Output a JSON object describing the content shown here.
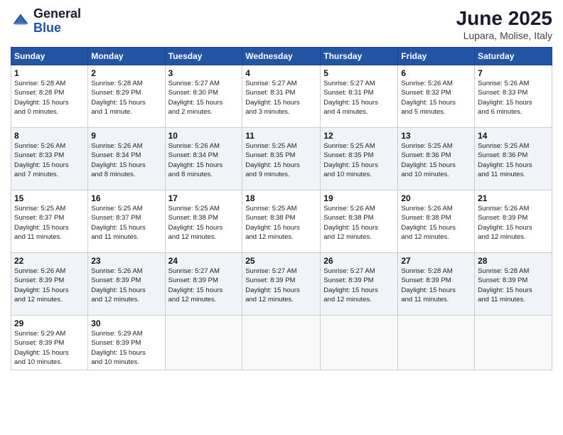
{
  "logo": {
    "general": "General",
    "blue": "Blue"
  },
  "title": "June 2025",
  "location": "Lupara, Molise, Italy",
  "days_header": [
    "Sunday",
    "Monday",
    "Tuesday",
    "Wednesday",
    "Thursday",
    "Friday",
    "Saturday"
  ],
  "weeks": [
    [
      {
        "day": "1",
        "sunrise": "5:28 AM",
        "sunset": "8:28 PM",
        "daylight": "15 hours and 0 minutes."
      },
      {
        "day": "2",
        "sunrise": "5:28 AM",
        "sunset": "8:29 PM",
        "daylight": "15 hours and 1 minute."
      },
      {
        "day": "3",
        "sunrise": "5:27 AM",
        "sunset": "8:30 PM",
        "daylight": "15 hours and 2 minutes."
      },
      {
        "day": "4",
        "sunrise": "5:27 AM",
        "sunset": "8:31 PM",
        "daylight": "15 hours and 3 minutes."
      },
      {
        "day": "5",
        "sunrise": "5:27 AM",
        "sunset": "8:31 PM",
        "daylight": "15 hours and 4 minutes."
      },
      {
        "day": "6",
        "sunrise": "5:26 AM",
        "sunset": "8:32 PM",
        "daylight": "15 hours and 5 minutes."
      },
      {
        "day": "7",
        "sunrise": "5:26 AM",
        "sunset": "8:33 PM",
        "daylight": "15 hours and 6 minutes."
      }
    ],
    [
      {
        "day": "8",
        "sunrise": "5:26 AM",
        "sunset": "8:33 PM",
        "daylight": "15 hours and 7 minutes."
      },
      {
        "day": "9",
        "sunrise": "5:26 AM",
        "sunset": "8:34 PM",
        "daylight": "15 hours and 8 minutes."
      },
      {
        "day": "10",
        "sunrise": "5:26 AM",
        "sunset": "8:34 PM",
        "daylight": "15 hours and 8 minutes."
      },
      {
        "day": "11",
        "sunrise": "5:25 AM",
        "sunset": "8:35 PM",
        "daylight": "15 hours and 9 minutes."
      },
      {
        "day": "12",
        "sunrise": "5:25 AM",
        "sunset": "8:35 PM",
        "daylight": "15 hours and 10 minutes."
      },
      {
        "day": "13",
        "sunrise": "5:25 AM",
        "sunset": "8:36 PM",
        "daylight": "15 hours and 10 minutes."
      },
      {
        "day": "14",
        "sunrise": "5:25 AM",
        "sunset": "8:36 PM",
        "daylight": "15 hours and 11 minutes."
      }
    ],
    [
      {
        "day": "15",
        "sunrise": "5:25 AM",
        "sunset": "8:37 PM",
        "daylight": "15 hours and 11 minutes."
      },
      {
        "day": "16",
        "sunrise": "5:25 AM",
        "sunset": "8:37 PM",
        "daylight": "15 hours and 11 minutes."
      },
      {
        "day": "17",
        "sunrise": "5:25 AM",
        "sunset": "8:38 PM",
        "daylight": "15 hours and 12 minutes."
      },
      {
        "day": "18",
        "sunrise": "5:25 AM",
        "sunset": "8:38 PM",
        "daylight": "15 hours and 12 minutes."
      },
      {
        "day": "19",
        "sunrise": "5:26 AM",
        "sunset": "8:38 PM",
        "daylight": "15 hours and 12 minutes."
      },
      {
        "day": "20",
        "sunrise": "5:26 AM",
        "sunset": "8:38 PM",
        "daylight": "15 hours and 12 minutes."
      },
      {
        "day": "21",
        "sunrise": "5:26 AM",
        "sunset": "8:39 PM",
        "daylight": "15 hours and 12 minutes."
      }
    ],
    [
      {
        "day": "22",
        "sunrise": "5:26 AM",
        "sunset": "8:39 PM",
        "daylight": "15 hours and 12 minutes."
      },
      {
        "day": "23",
        "sunrise": "5:26 AM",
        "sunset": "8:39 PM",
        "daylight": "15 hours and 12 minutes."
      },
      {
        "day": "24",
        "sunrise": "5:27 AM",
        "sunset": "8:39 PM",
        "daylight": "15 hours and 12 minutes."
      },
      {
        "day": "25",
        "sunrise": "5:27 AM",
        "sunset": "8:39 PM",
        "daylight": "15 hours and 12 minutes."
      },
      {
        "day": "26",
        "sunrise": "5:27 AM",
        "sunset": "8:39 PM",
        "daylight": "15 hours and 12 minutes."
      },
      {
        "day": "27",
        "sunrise": "5:28 AM",
        "sunset": "8:39 PM",
        "daylight": "15 hours and 11 minutes."
      },
      {
        "day": "28",
        "sunrise": "5:28 AM",
        "sunset": "8:39 PM",
        "daylight": "15 hours and 11 minutes."
      }
    ],
    [
      {
        "day": "29",
        "sunrise": "5:29 AM",
        "sunset": "8:39 PM",
        "daylight": "15 hours and 10 minutes."
      },
      {
        "day": "30",
        "sunrise": "5:29 AM",
        "sunset": "8:39 PM",
        "daylight": "15 hours and 10 minutes."
      },
      null,
      null,
      null,
      null,
      null
    ]
  ]
}
